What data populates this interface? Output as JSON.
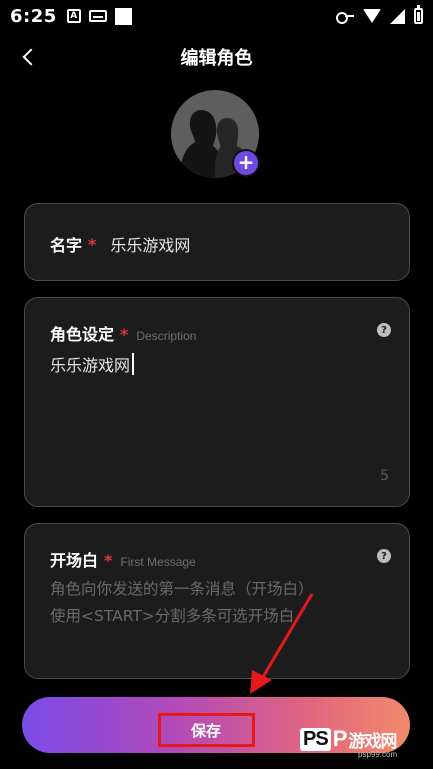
{
  "status_bar": {
    "time": "6:25",
    "icons_left": [
      "a-box-icon",
      "keyboard-icon",
      "square-icon"
    ],
    "icons_right": [
      "vpn-key-icon",
      "wifi-icon",
      "signal-icon",
      "battery-icon"
    ]
  },
  "header": {
    "title": "编辑角色"
  },
  "avatar": {
    "add_symbol": "+"
  },
  "name_field": {
    "label": "名字",
    "required_mark": "*",
    "value": "乐乐游戏网"
  },
  "description_field": {
    "label": "角色设定",
    "required_mark": "*",
    "sub_label": "Description",
    "help_symbol": "?",
    "value": "乐乐游戏网",
    "char_count": "5"
  },
  "first_message_field": {
    "label": "开场白",
    "required_mark": "*",
    "sub_label": "First Message",
    "help_symbol": "?",
    "placeholder_line1": "角色向你发送的第一条消息（开场白）",
    "placeholder_line2": "使用<START>分割多条可选开场白"
  },
  "save_button": {
    "label": "保存",
    "gradient": [
      "#7a4be8",
      "#b34ab8",
      "#e2677e",
      "#f08a6a"
    ]
  },
  "annotation": {
    "arrow_color": "#e3191b",
    "highlight_color": "#e3191b"
  },
  "watermark": {
    "ps": "PS",
    "p": "P",
    "text": "游戏网",
    "url": "psp99.com"
  },
  "colors": {
    "background": "#000000",
    "card_bg": "#1c1c1c",
    "card_border": "#4a4a4a",
    "required": "#d83a3a",
    "accent": "#6d4be0"
  }
}
